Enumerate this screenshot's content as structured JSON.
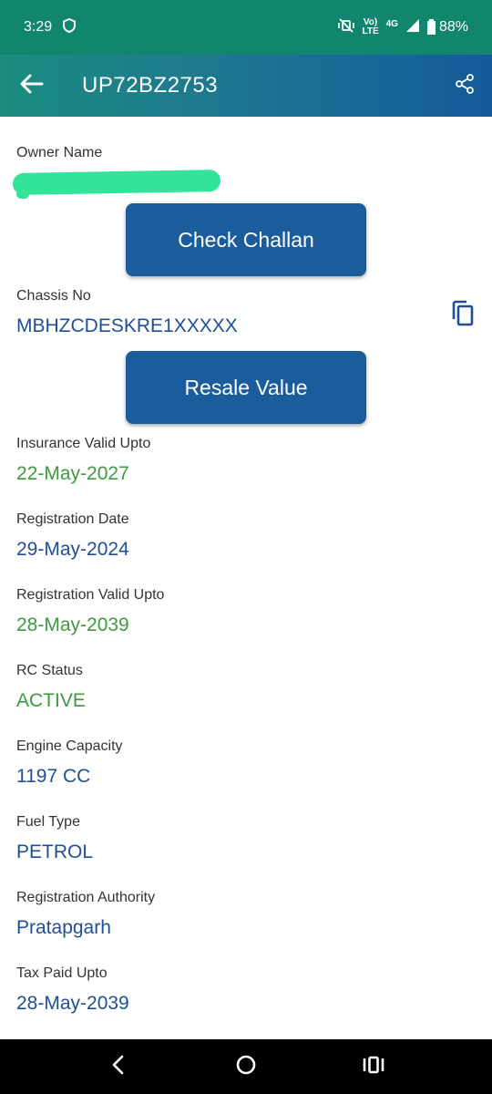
{
  "status_bar": {
    "time": "3:29",
    "network_top": "Vo)",
    "network_bottom": "LTE",
    "network_type": "4G",
    "battery": "88%",
    "icons": [
      "shield-icon",
      "mute-icon",
      "signal-icon",
      "battery-icon"
    ]
  },
  "app_bar": {
    "title": "UP72BZ2753",
    "icons": [
      "back-arrow-icon",
      "share-icon"
    ]
  },
  "owner": {
    "label": "Owner Name"
  },
  "buttons": {
    "check_challan": "Check Challan",
    "resale_value": "Resale Value"
  },
  "chassis": {
    "label": "Chassis No",
    "value": "MBHZCDESKRE1XXXXX",
    "icon": "copy-icon"
  },
  "fields": [
    {
      "label": "Insurance Valid Upto",
      "value": "22-May-2027",
      "color": "#3e9a3f"
    },
    {
      "label": "Registration Date",
      "value": "29-May-2024",
      "color": "#1f4f96"
    },
    {
      "label": "Registration Valid Upto",
      "value": "28-May-2039",
      "color": "#3e9a3f"
    },
    {
      "label": "RC Status",
      "value": "ACTIVE",
      "color": "#3e9a3f"
    },
    {
      "label": "Engine Capacity",
      "value": "1197 CC",
      "color": "#1f4f96"
    },
    {
      "label": "Fuel Type",
      "value": "PETROL",
      "color": "#1f4f96"
    },
    {
      "label": "Registration Authority",
      "value": "Pratapgarh",
      "color": "#1f4f96"
    },
    {
      "label": "Tax Paid Upto",
      "value": "28-May-2039",
      "color": "#1f4f96"
    }
  ],
  "nav_bar": {
    "icons": [
      "back-nav-icon",
      "home-icon",
      "recents-icon"
    ]
  },
  "colors": {
    "status_bar": "#12856f",
    "app_bar_start": "#1b8c7e",
    "app_bar_end": "#155a9b",
    "button": "#1b5c9c",
    "value_blue": "#1f4f96",
    "value_green": "#3e9a3f",
    "redaction": "#33e39a"
  }
}
